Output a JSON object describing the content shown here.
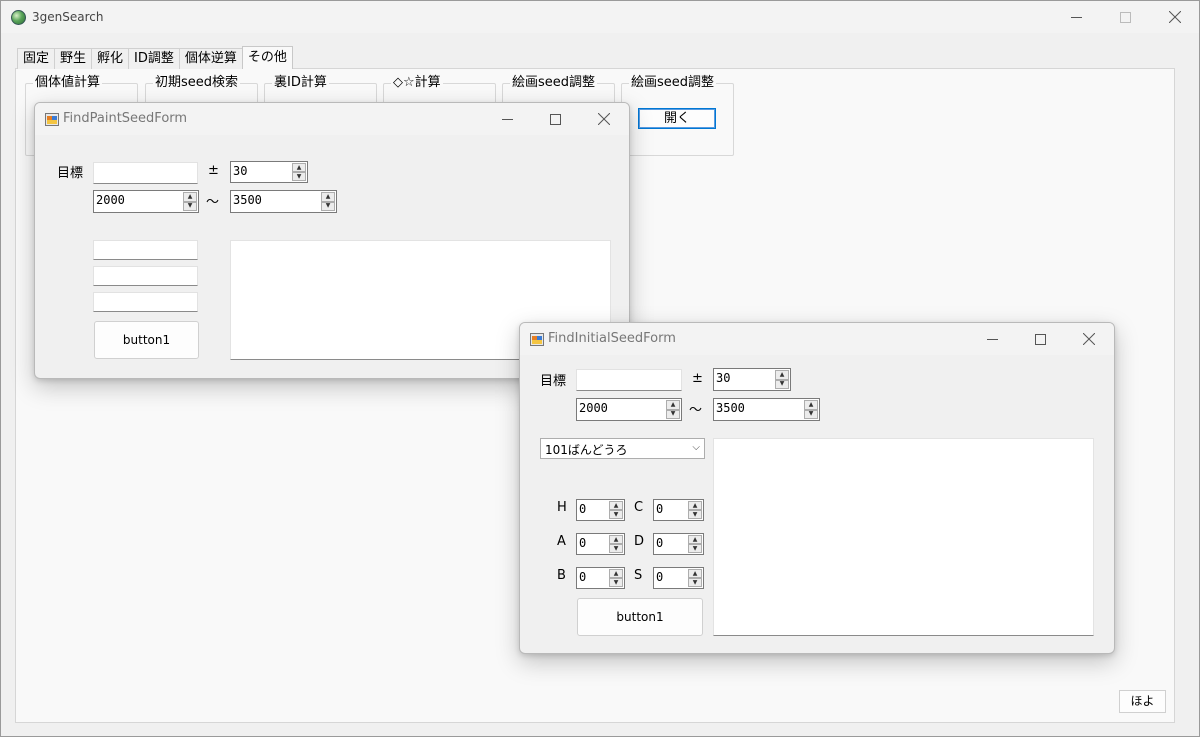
{
  "main": {
    "title": "3genSearch",
    "tabs": [
      "固定",
      "野生",
      "孵化",
      "ID調整",
      "個体逆算",
      "その他"
    ],
    "groups": [
      "個体値計算",
      "初期seed検索",
      "裏ID計算",
      "◇☆計算",
      "絵画seed調整",
      "絵画seed調整"
    ],
    "open_label": "開く",
    "hoyo_label": "ほよ"
  },
  "paint_form": {
    "title": "FindPaintSeedForm",
    "target_label": "目標",
    "pm_label": "±",
    "range_label": "～",
    "tolerance": "30",
    "min": "2000",
    "max": "3500",
    "button_label": "button1"
  },
  "initial_form": {
    "title": "FindInitialSeedForm",
    "target_label": "目標",
    "pm_label": "±",
    "range_label": "～",
    "tolerance": "30",
    "min": "2000",
    "max": "3500",
    "route_selected": "101ばんどうろ",
    "stats": {
      "h_label": "H",
      "h_value": "0",
      "a_label": "A",
      "a_value": "0",
      "b_label": "B",
      "b_value": "0",
      "c_label": "C",
      "c_value": "0",
      "d_label": "D",
      "d_value": "0",
      "s_label": "S",
      "s_value": "0"
    },
    "button_label": "button1"
  },
  "icons": {
    "app": "pokeball-icon",
    "form": "form-icon",
    "minimize": "minimize-icon",
    "maximize": "maximize-icon",
    "close": "close-icon"
  }
}
